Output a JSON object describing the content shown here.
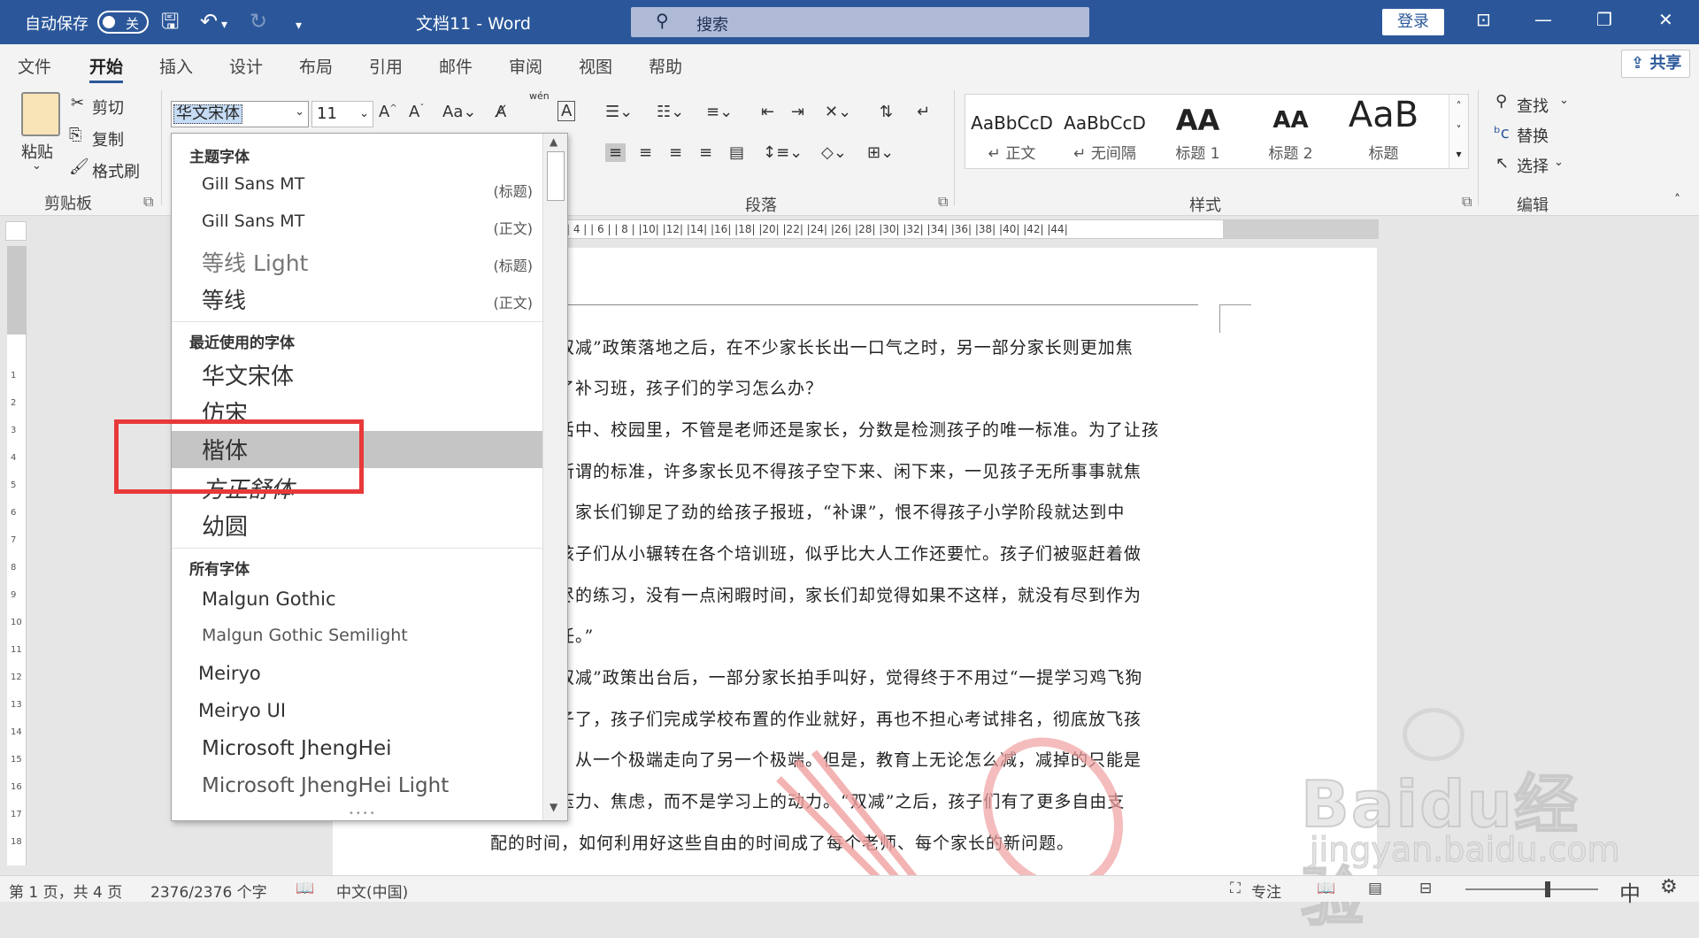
{
  "titlebar": {
    "autosave": "自动保存",
    "autosave_state": "关",
    "doc_title": "文档11  -  Word",
    "search_placeholder": "搜索",
    "login": "登录"
  },
  "tabs": [
    "文件",
    "开始",
    "插入",
    "设计",
    "布局",
    "引用",
    "邮件",
    "审阅",
    "视图",
    "帮助"
  ],
  "active_tab": "开始",
  "share": "共享",
  "ribbon": {
    "clipboard": {
      "paste": "粘贴",
      "cut": "剪切",
      "copy": "复制",
      "format_painter": "格式刷",
      "label": "剪贴板"
    },
    "font": {
      "current_font": "华文宋体",
      "current_size": "11",
      "clear_icon": "wén"
    },
    "paragraph": {
      "label": "段落"
    },
    "styles": {
      "label": "样式",
      "items": [
        {
          "preview": "AaBbCcD",
          "label": "↵ 正文"
        },
        {
          "preview": "AaBbCcD",
          "label": "↵ 无间隔"
        },
        {
          "preview": "AA",
          "label": "标题 1"
        },
        {
          "preview": "AA",
          "label": "标题 2"
        },
        {
          "preview": "AaB",
          "label": "标题"
        }
      ]
    },
    "editing": {
      "find": "查找",
      "replace": "替换",
      "select": "选择",
      "label": "编辑"
    }
  },
  "ruler_marks": "| 4 |  | 6 |  | 8 |  |10|  |12|  |14|  |16|  |18|  |20|  |22|  |24|  |26|  |28|  |30|  |32|  |34|  |36|  |38|  |40|  |42|  |44|",
  "font_dropdown": {
    "theme_header": "主题字体",
    "theme_fonts": [
      {
        "name": "Gill Sans MT",
        "tag": "(标题)"
      },
      {
        "name": "Gill Sans MT",
        "tag": "(正文)"
      },
      {
        "name": "等线 Light",
        "tag": "(标题)"
      },
      {
        "name": "等线",
        "tag": "(正文)"
      }
    ],
    "recent_header": "最近使用的字体",
    "recent_fonts": [
      "华文宋体",
      "仿宋",
      "楷体",
      "方正舒体",
      "幼圆"
    ],
    "selected": "楷体",
    "all_header": "所有字体",
    "all_fonts": [
      "Malgun Gothic",
      "Malgun Gothic Semilight",
      "Meiryo",
      "Meiryo UI",
      "Microsoft JhengHei",
      "Microsoft JhengHei Light"
    ]
  },
  "document": {
    "lines": [
      "双减”政策落地之后，在不少家长长出一口气之时，另一部分家长则更加焦",
      "了补习班，孩子们的学习怎么办？",
      "活中、校园里，不管是老师还是家长，分数是检测孩子的唯一标准。为了让孩",
      "所谓的标准，许多家长见不得孩子空下来、闲下来，一见孩子无所事事就焦",
      "，家长们铆足了劲的给孩子报班，“补课”，恨不得孩子小学阶段就达到中",
      "孩子们从小辗转在各个培训班，似乎比大人工作还要忙。孩子们被驱赶着做",
      "尽的练习，没有一点闲暇时间，家长们却觉得如果不这样，就没有尽到作为",
      "任。”",
      "双减”政策出台后，一部分家长拍手叫好，觉得终于不用过“一提学习鸡飞狗",
      "子了，孩子们完成学校布置的作业就好，再也不担心考试排名，彻底放飞孩",
      "，从一个极端走向了另一个极端。但是，教育上无论怎么减，减掉的只能是",
      "压力、焦虑，而不是学习上的动力。“双减”之后，孩子们有了更多自由支",
      "配的时间，如何利用好这些自由的时间成了每个老师、每个家长的新问题。"
    ]
  },
  "status": {
    "page": "第 1 页，共 4 页",
    "words": "2376/2376 个字",
    "lang": "中文(中国)",
    "focus": "专注",
    "ime": "中"
  },
  "watermark": {
    "brand": "Baidu经验",
    "url": "jingyan.baidu.com"
  },
  "accent": "#2b579a",
  "highlight_color": "#e8393a"
}
